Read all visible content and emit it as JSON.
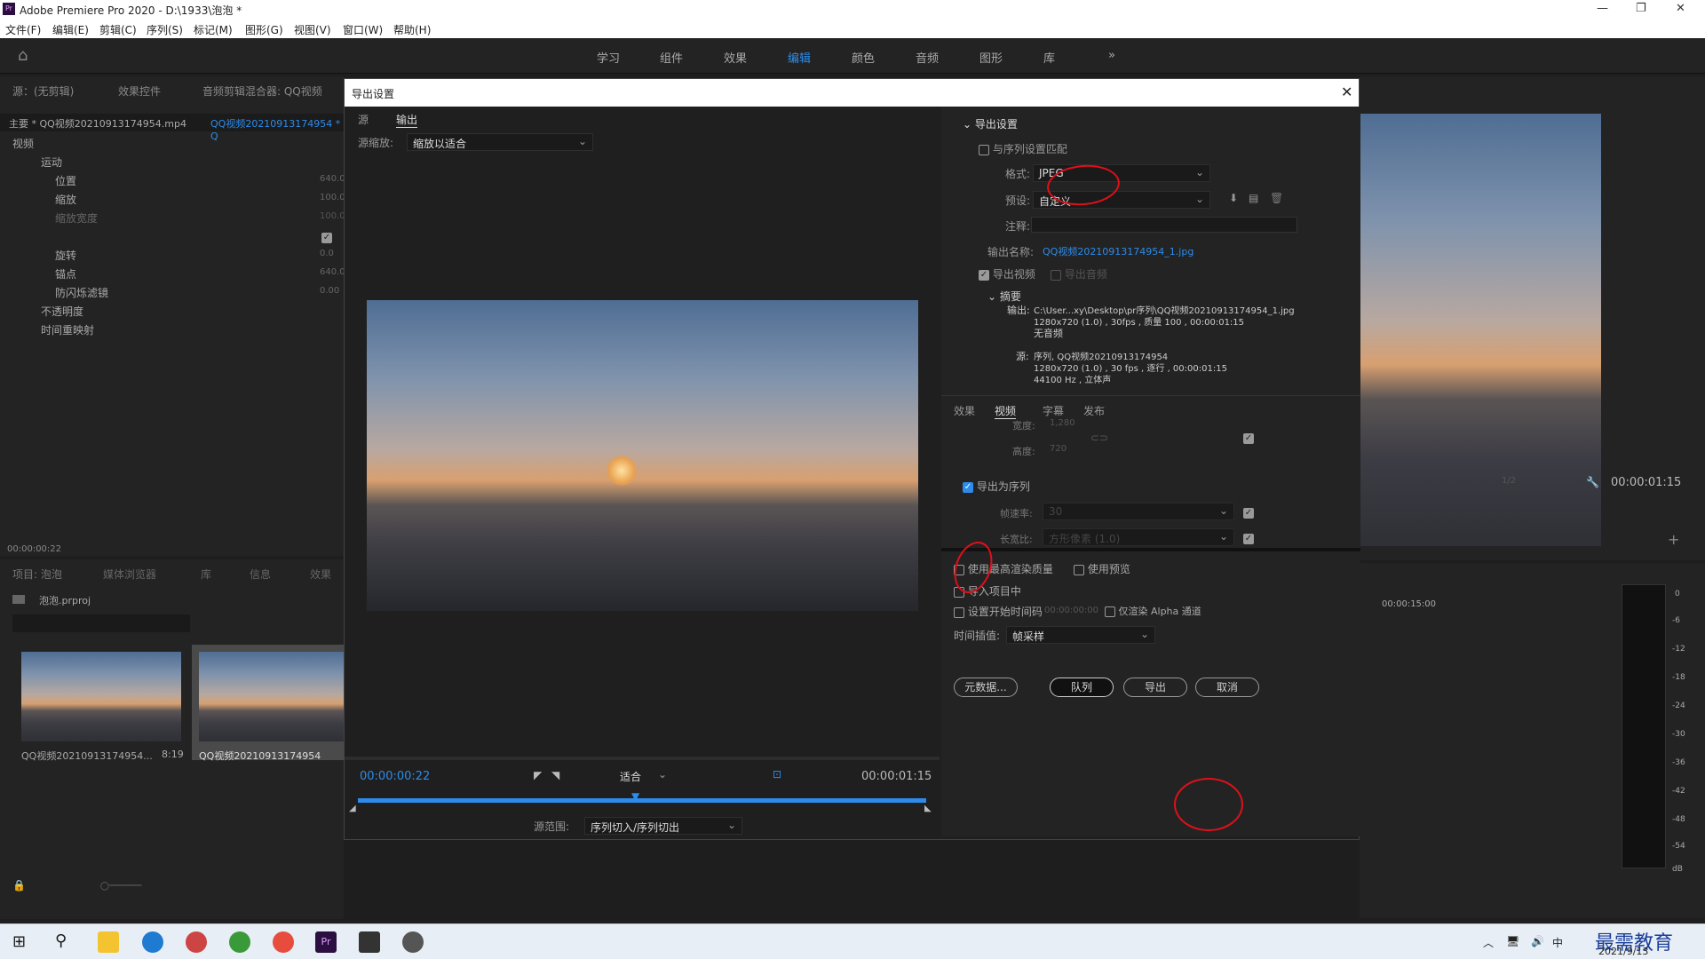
{
  "app": {
    "title": "Adobe Premiere Pro 2020 - D:\\1933\\泡泡 *"
  },
  "menu": [
    "文件(F)",
    "编辑(E)",
    "剪辑(C)",
    "序列(S)",
    "标记(M)",
    "图形(G)",
    "视图(V)",
    "窗口(W)",
    "帮助(H)"
  ],
  "workspaces": [
    "学习",
    "组件",
    "效果",
    "编辑",
    "颜色",
    "音频",
    "图形",
    "库"
  ],
  "left_panel": {
    "tabs": [
      "源：(无剪辑)",
      "效果控件",
      "音频剪辑混合器: QQ视频"
    ],
    "master": "主要 * QQ视频20210913174954.mp4",
    "clip": "QQ视频20210913174954 * Q",
    "video": "视频",
    "props": [
      "运动",
      "位置",
      "缩放",
      "缩放宽度",
      "旋转",
      "锚点",
      "防闪烁滤镜",
      "不透明度",
      "时间重映射"
    ],
    "values": [
      "640.0",
      "100.0",
      "100.0",
      "0.0",
      "640.0",
      "0.00"
    ],
    "timecode": "00:00:00:22"
  },
  "project": {
    "tabs": [
      "项目: 泡泡",
      "媒体浏览器",
      "库",
      "信息",
      "效果"
    ],
    "file": "泡泡.prproj",
    "items": [
      {
        "name": "QQ视频20210913174954...",
        "dur": "8:19"
      },
      {
        "name": "QQ视频20210913174954",
        "dur": ""
      }
    ]
  },
  "dialog": {
    "title": "导出设置",
    "tabs": [
      "源",
      "输出"
    ],
    "scale_label": "源缩放:",
    "scale_value": "缩放以适合",
    "tc_in": "00:00:00:22",
    "tc_out": "00:00:01:15",
    "fit": "适合",
    "range_label": "源范围:",
    "range_value": "序列切入/序列切出",
    "export_settings": "导出设置",
    "match_seq": "与序列设置匹配",
    "format_label": "格式:",
    "format": "JPEG",
    "preset_label": "预设:",
    "preset": "自定义",
    "comment_label": "注释:",
    "output_name_label": "输出名称:",
    "output_name": "QQ视频20210913174954_1.jpg",
    "export_video": "导出视频",
    "export_audio": "导出音频",
    "summary": "摘要",
    "out_label": "输出:",
    "out_path": "C:\\User...xy\\Desktop\\pr序列\\QQ视频20210913174954_1.jpg",
    "out_spec": "1280x720 (1.0) , 30fps , 质量 100 , 00:00:01:15",
    "no_audio": "无音频",
    "src_label": "源:",
    "src_name": "序列, QQ视频20210913174954",
    "src_spec": "1280x720 (1.0) , 30 fps , 逐行 , 00:00:01:15",
    "src_audio": "44100 Hz , 立体声",
    "sub_tabs": [
      "效果",
      "视频",
      "字幕",
      "发布"
    ],
    "width_label": "宽度:",
    "width": "1,280",
    "height_label": "高度:",
    "height": "720",
    "export_seq": "导出为序列",
    "fps_label": "帧速率:",
    "fps": "30",
    "aspect_label": "长宽比:",
    "aspect": "方形像素 (1.0)",
    "max_quality": "使用最高渲染质量",
    "use_preview": "使用预览",
    "import_proj": "导入项目中",
    "start_tc": "设置开始时间码",
    "start_tc_val": "00:00:00:00",
    "alpha_only": "仅渲染 Alpha 通道",
    "interp_label": "时间插值:",
    "interp": "帧采样",
    "buttons": {
      "metadata": "元数据...",
      "queue": "队列",
      "export": "导出",
      "cancel": "取消"
    }
  },
  "program": {
    "timecode": "00:00:01:15",
    "fraction": "1/2",
    "timeline_tc": "00:00:15:00",
    "meter": [
      "0",
      "-6",
      "-12",
      "-18",
      "-24",
      "-30",
      "-36",
      "-42",
      "-48",
      "-54",
      "dB"
    ]
  },
  "taskbar": {
    "date": "2021/9/13",
    "ime": "中",
    "watermark": "最需教育"
  }
}
